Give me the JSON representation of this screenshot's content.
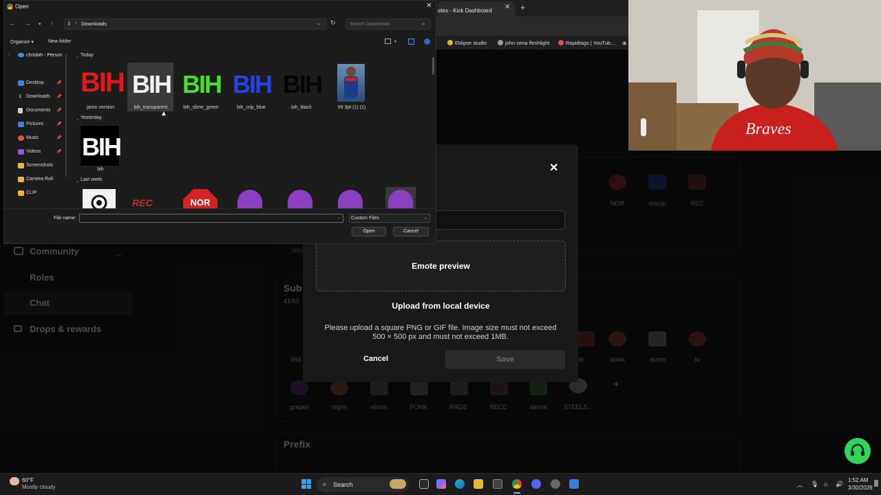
{
  "browser": {
    "tab_title": "otes - Kick Dashboard",
    "bookmarks": [
      "Eklipse studio",
      "john cena fleshlight",
      "Rapidtags | YouTub..."
    ]
  },
  "kick": {
    "sidebar": {
      "community": "Community",
      "roles": "Roles",
      "chat": "Chat",
      "drops": "Drops & rewards"
    },
    "emotes_top": [
      "NOR",
      "oncrip",
      "REC"
    ],
    "section_sub": "Sub",
    "sub_count": "41/60",
    "sub_row1_left": "993",
    "sub_row1": [
      "nh",
      "dorkk",
      "dumb",
      "fu"
    ],
    "sub_row2": [
      "grapes",
      "highh",
      "nihnet",
      "PONK",
      "RAGE",
      "RECC",
      "slimee",
      "STEELS..."
    ],
    "prefix": "Prefix",
    "partial_label": "slim"
  },
  "modal": {
    "preview": "Emote preview",
    "upload": "Upload from local device",
    "desc_line1": "Please upload a square PNG or GIF file. Image size must not exceed",
    "desc_line2": "500 × 500 px and must not exceed 1MB.",
    "cancel": "Cancel",
    "save": "Save"
  },
  "dialog": {
    "title": "Open",
    "path": "Downloads",
    "search_placeholder": "Search Downloads",
    "organize": "Organize ▾",
    "new_folder": "New folder",
    "nav": {
      "account": "chrisbih - Person",
      "items": [
        "Desktop",
        "Downloads",
        "Documents",
        "Pictures",
        "Music",
        "Videos",
        "Screenshots",
        "Camera Roll",
        "CLIP"
      ]
    },
    "groups": {
      "today": "Today",
      "yesterday": "Yesterday",
      "last_week": "Last week"
    },
    "today_files": [
      "jaron version",
      "bih_transparent",
      "bih_slime_green",
      "bih_crip_blue",
      "bih_black",
      "99 3pt (1) (1)"
    ],
    "yesterday_files": [
      "bih"
    ],
    "bih_text": "BIH",
    "last_week_thumb_a": "REC",
    "last_week_thumb_b": "NOR",
    "file_name_label": "File name:",
    "file_name_value": "",
    "filter": "Custom Files",
    "open": "Open",
    "cancel": "Cancel"
  },
  "taskbar": {
    "temp": "60°F",
    "weather": "Mostly cloudy",
    "search": "Search",
    "time": "1:52 AM",
    "date": "3/30/2026"
  }
}
